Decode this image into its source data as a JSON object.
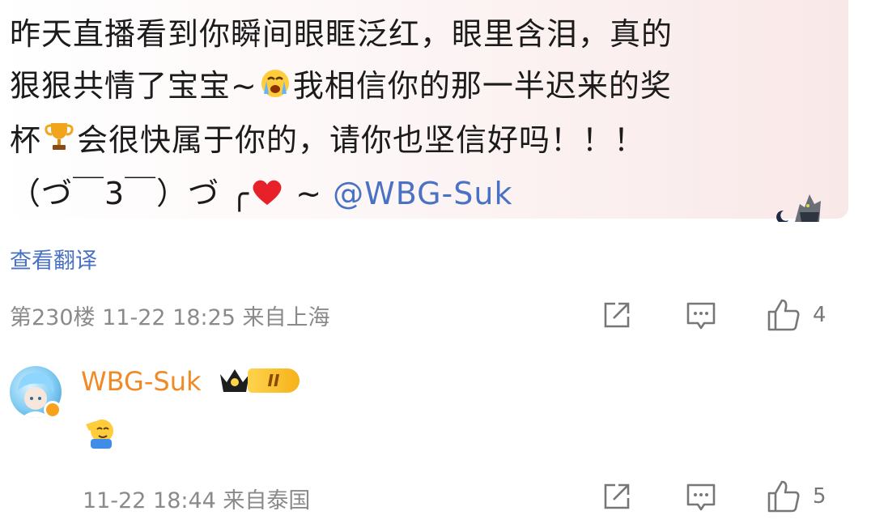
{
  "comment": {
    "line1": "昨天直播看到你瞬间眼眶泛红，眼里含泪，真的",
    "line2_a": "狠狠共情了宝宝~",
    "line2_b": "我相信你的那一半迟来的奖",
    "line3_a": "杯",
    "line3_b": "会很快属于你的，请你也坚信好吗！！！",
    "line4_a": "（づ￣3￣）づ ╭",
    "line4_b": " ~ ",
    "mention": "@WBG-Suk",
    "translate_label": "查看翻译",
    "meta": "第230楼 11-22 18:25 来自上海",
    "like_count": "4"
  },
  "reply": {
    "author": "WBG-Suk",
    "level": "II",
    "meta": "11-22 18:44 来自泰国",
    "like_count": "5"
  },
  "colors": {
    "link": "#4a72c4",
    "author": "#f08a24",
    "meta": "#8a8a8a"
  }
}
